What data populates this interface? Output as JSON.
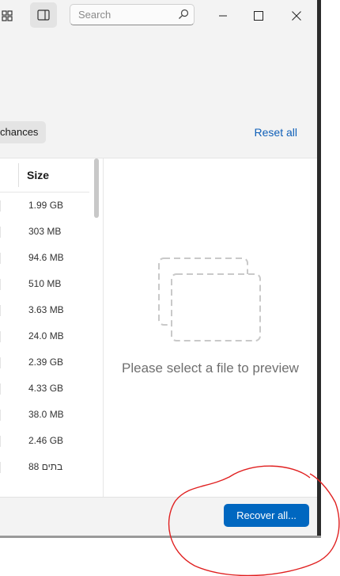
{
  "titlebar": {
    "search_placeholder": "Search",
    "icons": [
      "grid-icon",
      "panel-toggle-icon",
      "search-icon",
      "minimize-icon",
      "maximize-icon",
      "close-icon"
    ]
  },
  "filters": {
    "chip_label": "chances",
    "reset_label": "Reset all"
  },
  "list": {
    "size_header": "Size",
    "rows": [
      {
        "size": "1.99 GB"
      },
      {
        "size": "303 MB"
      },
      {
        "size": "94.6 MB"
      },
      {
        "size": "510 MB"
      },
      {
        "size": "3.63 MB"
      },
      {
        "size": "24.0 MB"
      },
      {
        "size": "2.39 GB"
      },
      {
        "size": "4.33 GB"
      },
      {
        "size": "38.0 MB"
      },
      {
        "size": "2.46 GB"
      },
      {
        "size": "88 בתים"
      }
    ]
  },
  "preview": {
    "message": "Please select a file to preview"
  },
  "footer": {
    "recover_label": "Recover all..."
  },
  "colors": {
    "accent": "#0067c0",
    "link": "#0f5fb8",
    "annotation": "#e02020"
  }
}
